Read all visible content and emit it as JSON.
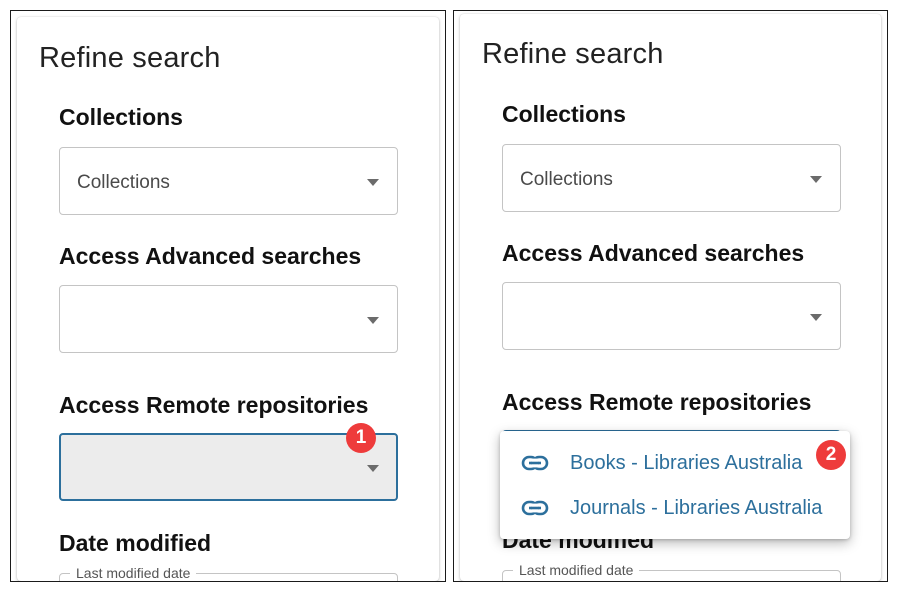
{
  "left_panel": {
    "title": "Refine search",
    "collections": {
      "label": "Collections",
      "value": "Collections"
    },
    "advanced": {
      "label": "Access Advanced searches",
      "value": ""
    },
    "remote": {
      "label": "Access Remote repositories",
      "value": ""
    },
    "date": {
      "label": "Date modified",
      "field_legend": "Last modified date"
    },
    "badge": "1"
  },
  "right_panel": {
    "title": "Refine search",
    "collections": {
      "label": "Collections",
      "value": "Collections"
    },
    "advanced": {
      "label": "Access Advanced searches",
      "value": ""
    },
    "remote": {
      "label": "Access Remote repositories"
    },
    "date": {
      "label": "Date modified",
      "field_legend": "Last modified date"
    },
    "badge": "2",
    "dropdown_options": [
      {
        "label": "Books - Libraries Australia",
        "icon": "link-icon"
      },
      {
        "label": "Journals - Libraries Australia",
        "icon": "link-icon"
      }
    ]
  },
  "colors": {
    "link": "#2c6f9c",
    "badge": "#ee3b3b",
    "active_border": "#2c6f9c"
  }
}
